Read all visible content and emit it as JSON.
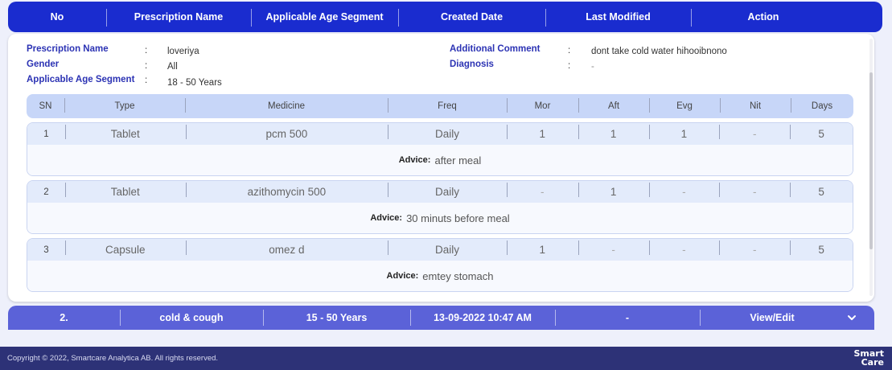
{
  "header": {
    "columns": [
      "No",
      "Prescription Name",
      "Applicable Age Segment",
      "Created Date",
      "Last Modified",
      "Action"
    ]
  },
  "details": {
    "prescription_name_label": "Prescription Name",
    "prescription_name": "loveriya",
    "gender_label": "Gender",
    "gender": "All",
    "age_segment_label": "Applicable Age Segment",
    "age_segment": "18 - 50 Years",
    "comment_label": "Additional Comment",
    "comment": "dont take cold water hihooibnono",
    "diagnosis_label": "Diagnosis",
    "diagnosis": "-",
    "colon": ":"
  },
  "medicine_table": {
    "headers": [
      "SN",
      "Type",
      "Medicine",
      "Freq",
      "Mor",
      "Aft",
      "Evg",
      "Nit",
      "Days"
    ],
    "advice_label": "Advice:",
    "rows": [
      {
        "sn": "1",
        "type": "Tablet",
        "medicine": "pcm 500",
        "freq": "Daily",
        "mor": "1",
        "aft": "1",
        "evg": "1",
        "nit": "-",
        "days": "5",
        "advice": "after meal"
      },
      {
        "sn": "2",
        "type": "Tablet",
        "medicine": "azithomycin 500",
        "freq": "Daily",
        "mor": "-",
        "aft": "1",
        "evg": "-",
        "nit": "-",
        "days": "5",
        "advice": "30 minuts before meal"
      },
      {
        "sn": "3",
        "type": "Capsule",
        "medicine": "omez d",
        "freq": "Daily",
        "mor": "1",
        "aft": "-",
        "evg": "-",
        "nit": "-",
        "days": "5",
        "advice": "emtey stomach"
      }
    ]
  },
  "collapsed_row": {
    "no": "2.",
    "name": "cold & cough",
    "age": "15 - 50 Years",
    "created": "13-09-2022 10:47 AM",
    "modified": "-",
    "action": "View/Edit"
  },
  "footer": {
    "copyright": "Copyright © 2022, Smartcare Analytica AB. All rights reserved.",
    "logo_line1": "Smart",
    "logo_line2": "Care"
  },
  "colors": {
    "header_bg": "#1a2ccf",
    "collapsed_row_bg": "#5b62d8",
    "footer_bg": "#2d3277",
    "label_blue": "#2c33b4"
  }
}
